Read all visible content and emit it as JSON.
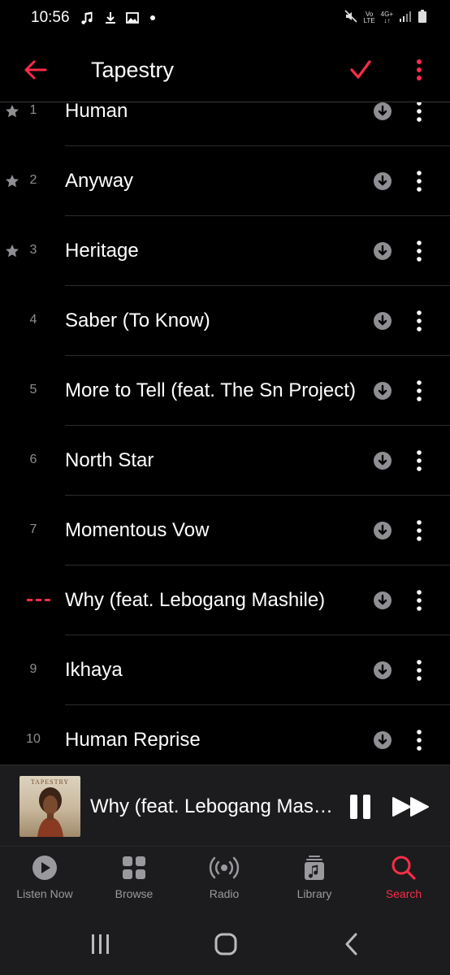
{
  "status_bar": {
    "time": "10:56",
    "left_icons": [
      "music-note-icon",
      "download-arrow-icon",
      "image-icon",
      "dot-icon"
    ],
    "net_top": "Vo",
    "net_bottom": "LTE",
    "net2_top": "4G+",
    "right_icons": [
      "mute-icon",
      "signal-icon",
      "battery-icon"
    ]
  },
  "header": {
    "title": "Tapestry",
    "accent": "#fa2d48"
  },
  "tracks": [
    {
      "num": "1",
      "title": "Human",
      "starred": true
    },
    {
      "num": "2",
      "title": "Anyway",
      "starred": true
    },
    {
      "num": "3",
      "title": "Heritage",
      "starred": true
    },
    {
      "num": "4",
      "title": "Saber (To Know)",
      "starred": false
    },
    {
      "num": "5",
      "title": "More to Tell (feat. The Sn Project)",
      "starred": false
    },
    {
      "num": "6",
      "title": "North Star",
      "starred": false
    },
    {
      "num": "7",
      "title": "Momentous Vow",
      "starred": false
    },
    {
      "num": "",
      "title": "Why (feat. Lebogang Mashile)",
      "starred": false,
      "playing": true
    },
    {
      "num": "9",
      "title": "Ikhaya",
      "starred": false
    },
    {
      "num": "10",
      "title": "Human Reprise",
      "starred": false
    }
  ],
  "mini_player": {
    "title": "Why (feat. Lebogang Mashile)",
    "art_text": "TAPESTRY"
  },
  "tabs": [
    {
      "label": "Listen Now",
      "icon": "play-circle-icon",
      "active": false
    },
    {
      "label": "Browse",
      "icon": "grid-icon",
      "active": false
    },
    {
      "label": "Radio",
      "icon": "radio-waves-icon",
      "active": false
    },
    {
      "label": "Library",
      "icon": "library-icon",
      "active": false
    },
    {
      "label": "Search",
      "icon": "search-icon",
      "active": true
    }
  ],
  "colors": {
    "accent": "#fa2d48",
    "background": "#000000",
    "bar_background": "#1c1c1e",
    "secondary_text": "#8e8e93"
  }
}
